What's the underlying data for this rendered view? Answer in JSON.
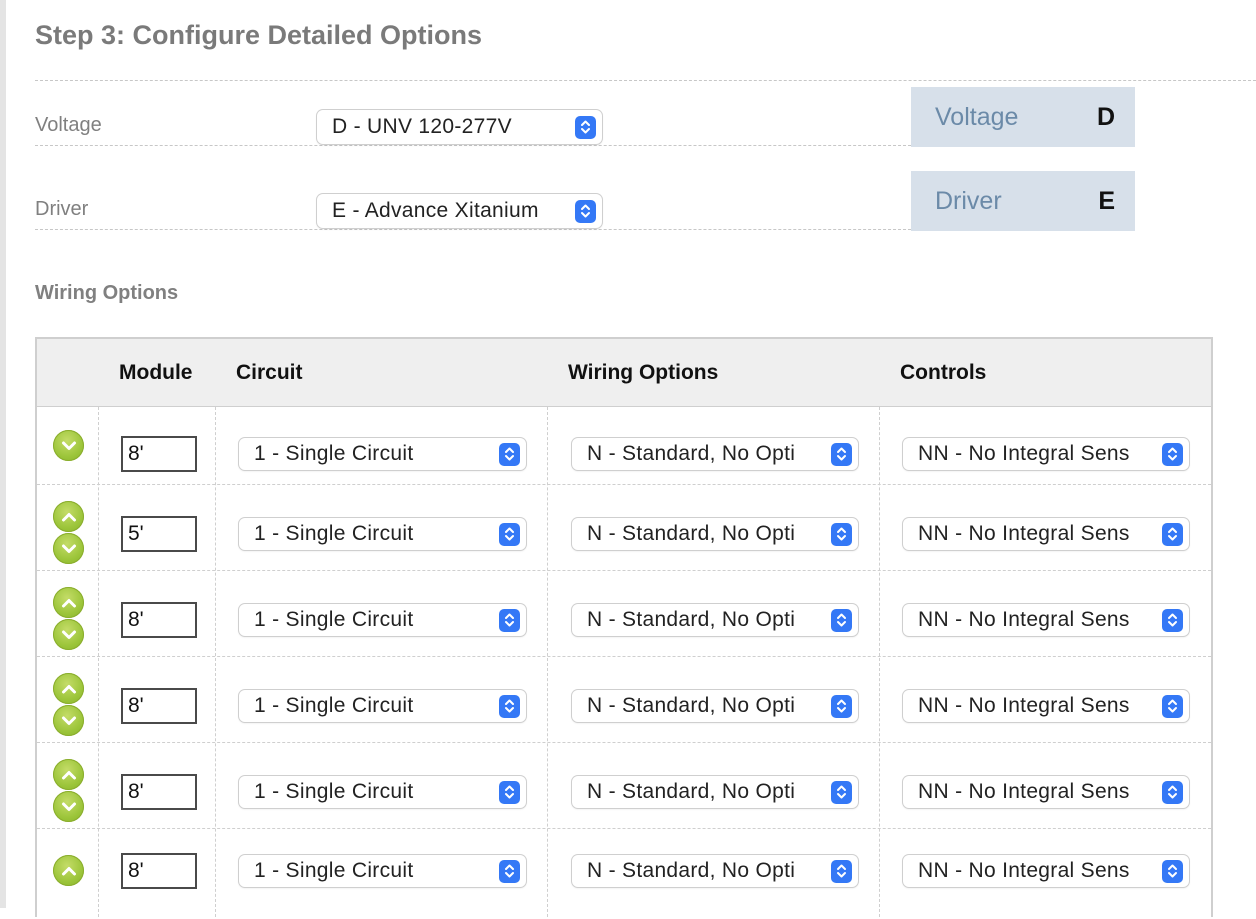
{
  "step_title": "Step 3: Configure Detailed Options",
  "options": [
    {
      "label": "Voltage",
      "selected": "D - UNV 120-277V",
      "summary_label": "Voltage",
      "summary_code": "D"
    },
    {
      "label": "Driver",
      "selected": "E - Advance Xitanium",
      "summary_label": "Driver",
      "summary_code": "E"
    }
  ],
  "wiring": {
    "heading": "Wiring Options",
    "columns": {
      "module": "Module",
      "circuit": "Circuit",
      "wiring": "Wiring Options",
      "controls": "Controls"
    },
    "rows": [
      {
        "module": "8'",
        "circuit": "1 - Single Circuit",
        "wiring": "N - Standard, No Opti",
        "controls": "NN - No Integral Sens"
      },
      {
        "module": "5'",
        "circuit": "1 - Single Circuit",
        "wiring": "N - Standard, No Opti",
        "controls": "NN - No Integral Sens"
      },
      {
        "module": "8'",
        "circuit": "1 - Single Circuit",
        "wiring": "N - Standard, No Opti",
        "controls": "NN - No Integral Sens"
      },
      {
        "module": "8'",
        "circuit": "1 - Single Circuit",
        "wiring": "N - Standard, No Opti",
        "controls": "NN - No Integral Sens"
      },
      {
        "module": "8'",
        "circuit": "1 - Single Circuit",
        "wiring": "N - Standard, No Opti",
        "controls": "NN - No Integral Sens"
      },
      {
        "module": "8'",
        "circuit": "1 - Single Circuit",
        "wiring": "N - Standard, No Opti",
        "controls": "NN - No Integral Sens"
      }
    ]
  },
  "icons": {
    "select_stepper": "select-stepper-icon",
    "move_up": "move-up-icon",
    "move_down": "move-down-icon"
  },
  "colors": {
    "accent_blue": "#3478f6",
    "arrow_green": "#9cc53a",
    "summary_bg": "#d7e0ea",
    "summary_label": "#6b8aa8"
  }
}
